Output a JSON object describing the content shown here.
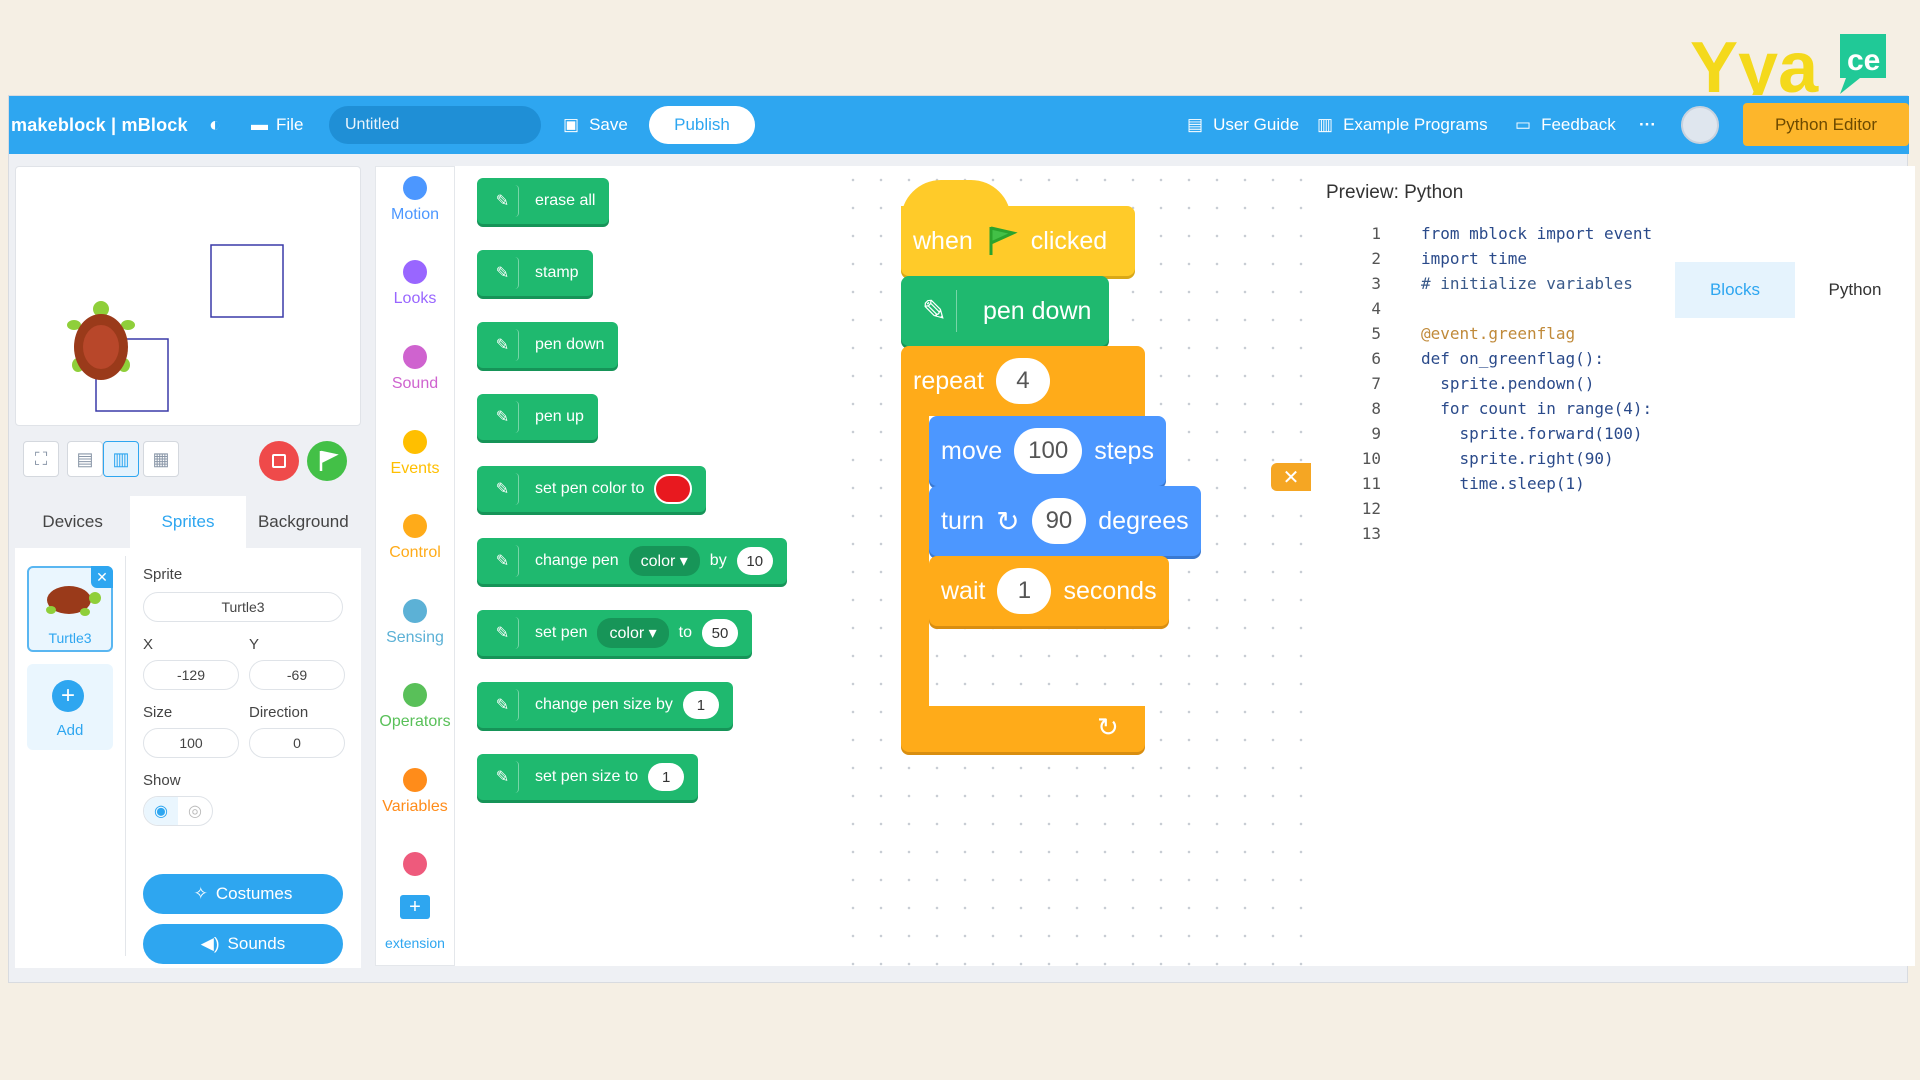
{
  "app": {
    "brand": "makeblock | mBlock",
    "file_label": "File",
    "project_title": "Untitled",
    "save_label": "Save",
    "publish_label": "Publish",
    "user_guide": "User Guide",
    "example_programs": "Example Programs",
    "feedback": "Feedback",
    "more": "···",
    "python_editor": "Python Editor"
  },
  "tabs": [
    "Devices",
    "Sprites",
    "Background"
  ],
  "sprite": {
    "thumb_label": "Turtle3",
    "add_label": "Add",
    "sprite_label": "Sprite",
    "name": "Turtle3",
    "x_label": "X",
    "y_label": "Y",
    "x": "-129",
    "y": "-69",
    "size_label": "Size",
    "direction_label": "Direction",
    "size": "100",
    "direction": "0",
    "show_label": "Show",
    "costumes_label": "Costumes",
    "sounds_label": "Sounds"
  },
  "categories": [
    {
      "label": "Motion",
      "color": "#4c97ff"
    },
    {
      "label": "Looks",
      "color": "#9966ff"
    },
    {
      "label": "Sound",
      "color": "#cf63cf"
    },
    {
      "label": "Events",
      "color": "#ffbf00"
    },
    {
      "label": "Control",
      "color": "#ffab19"
    },
    {
      "label": "Sensing",
      "color": "#5cb1d6"
    },
    {
      "label": "Operators",
      "color": "#59c059"
    },
    {
      "label": "Variables",
      "color": "#ff8c1a"
    },
    {
      "label": "",
      "color": "#ee5a7c"
    }
  ],
  "extension_label": "extension",
  "palette": {
    "erase_all": "erase all",
    "stamp": "stamp",
    "pen_down": "pen down",
    "pen_up": "pen up",
    "set_pen_color_to": "set pen color to",
    "pen_color_swatch": "#e8191f",
    "change_pen": "change pen",
    "color_dd": "color ▾",
    "by": "by",
    "change_by_value": "10",
    "set_pen": "set pen",
    "to": "to",
    "set_to_value": "50",
    "change_pen_size_by": "change pen size by",
    "change_size_value": "1",
    "set_pen_size_to": "set pen size to",
    "set_size_value": "1"
  },
  "script": {
    "when": "when",
    "clicked": "clicked",
    "pen_down": "pen down",
    "repeat": "repeat",
    "repeat_count": "4",
    "move": "move",
    "move_value": "100",
    "steps": "steps",
    "turn": "turn",
    "turn_value": "90",
    "degrees": "degrees",
    "wait": "wait",
    "wait_value": "1",
    "seconds": "seconds"
  },
  "preview": {
    "title": "Preview:  Python",
    "tab_blocks": "Blocks",
    "tab_python": "Python",
    "lines": [
      {
        "n": "1",
        "code": "from mblock import event"
      },
      {
        "n": "2",
        "code": "import time"
      },
      {
        "n": "3",
        "code": "# initialize variables"
      },
      {
        "n": "4",
        "code": ""
      },
      {
        "n": "5",
        "code": "@event.greenflag"
      },
      {
        "n": "6",
        "code": "def on_greenflag():"
      },
      {
        "n": "7",
        "code": "  sprite.pendown()"
      },
      {
        "n": "8",
        "code": "  for count in range(4):"
      },
      {
        "n": "9",
        "code": "    sprite.forward(100)"
      },
      {
        "n": "10",
        "code": "    sprite.right(90)"
      },
      {
        "n": "11",
        "code": "    time.sleep(1)"
      },
      {
        "n": "12",
        "code": ""
      },
      {
        "n": "13",
        "code": ""
      }
    ]
  }
}
